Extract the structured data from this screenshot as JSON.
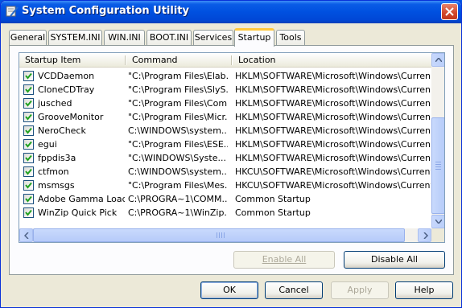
{
  "window": {
    "title": "System Configuration Utility",
    "close_label": "×"
  },
  "tabs": [
    {
      "label": "General"
    },
    {
      "label": "SYSTEM.INI"
    },
    {
      "label": "WIN.INI"
    },
    {
      "label": "BOOT.INI"
    },
    {
      "label": "Services"
    },
    {
      "label": "Startup",
      "active": true
    },
    {
      "label": "Tools"
    }
  ],
  "startup": {
    "columns": [
      "Startup Item",
      "Command",
      "Location"
    ],
    "rows": [
      {
        "checked": true,
        "item": "VCDDaemon",
        "command": "\"C:\\Program Files\\Elab...",
        "location": "HKLM\\SOFTWARE\\Microsoft\\Windows\\CurrentVer..."
      },
      {
        "checked": true,
        "item": "CloneCDTray",
        "command": "\"C:\\Program Files\\SlyS...",
        "location": "HKLM\\SOFTWARE\\Microsoft\\Windows\\CurrentVer..."
      },
      {
        "checked": true,
        "item": "jusched",
        "command": "\"C:\\Program Files\\Com...",
        "location": "HKLM\\SOFTWARE\\Microsoft\\Windows\\CurrentVer..."
      },
      {
        "checked": true,
        "item": "GrooveMonitor",
        "command": "\"C:\\Program Files\\Micr...",
        "location": "HKLM\\SOFTWARE\\Microsoft\\Windows\\CurrentVer..."
      },
      {
        "checked": true,
        "item": "NeroCheck",
        "command": "C:\\WINDOWS\\system...",
        "location": "HKLM\\SOFTWARE\\Microsoft\\Windows\\CurrentVer..."
      },
      {
        "checked": true,
        "item": "egui",
        "command": "\"C:\\Program Files\\ESE...",
        "location": "HKLM\\SOFTWARE\\Microsoft\\Windows\\CurrentVer..."
      },
      {
        "checked": true,
        "item": "fppdis3a",
        "command": "\"C:\\WINDOWS\\Syste...",
        "location": "HKLM\\SOFTWARE\\Microsoft\\Windows\\CurrentVer..."
      },
      {
        "checked": true,
        "item": "ctfmon",
        "command": "C:\\WINDOWS\\system...",
        "location": "HKCU\\SOFTWARE\\Microsoft\\Windows\\CurrentVer..."
      },
      {
        "checked": true,
        "item": "msmsgs",
        "command": "\"C:\\Program Files\\Mes...",
        "location": "HKCU\\SOFTWARE\\Microsoft\\Windows\\CurrentVer..."
      },
      {
        "checked": true,
        "item": "Adobe Gamma Loader",
        "command": "C:\\PROGRA~1\\COMM...",
        "location": "Common Startup"
      },
      {
        "checked": true,
        "item": "WinZip Quick Pick",
        "command": "C:\\PROGRA~1\\WinZip...",
        "location": "Common Startup"
      }
    ],
    "enable_all_label": "Enable All",
    "disable_all_label": "Disable All"
  },
  "buttons": {
    "ok": "OK",
    "cancel": "Cancel",
    "apply": "Apply",
    "help": "Help"
  },
  "colors": {
    "title_bar": "#0054e3",
    "active_tab_accent": "#ffc83c",
    "checkmark": "#21a121"
  }
}
